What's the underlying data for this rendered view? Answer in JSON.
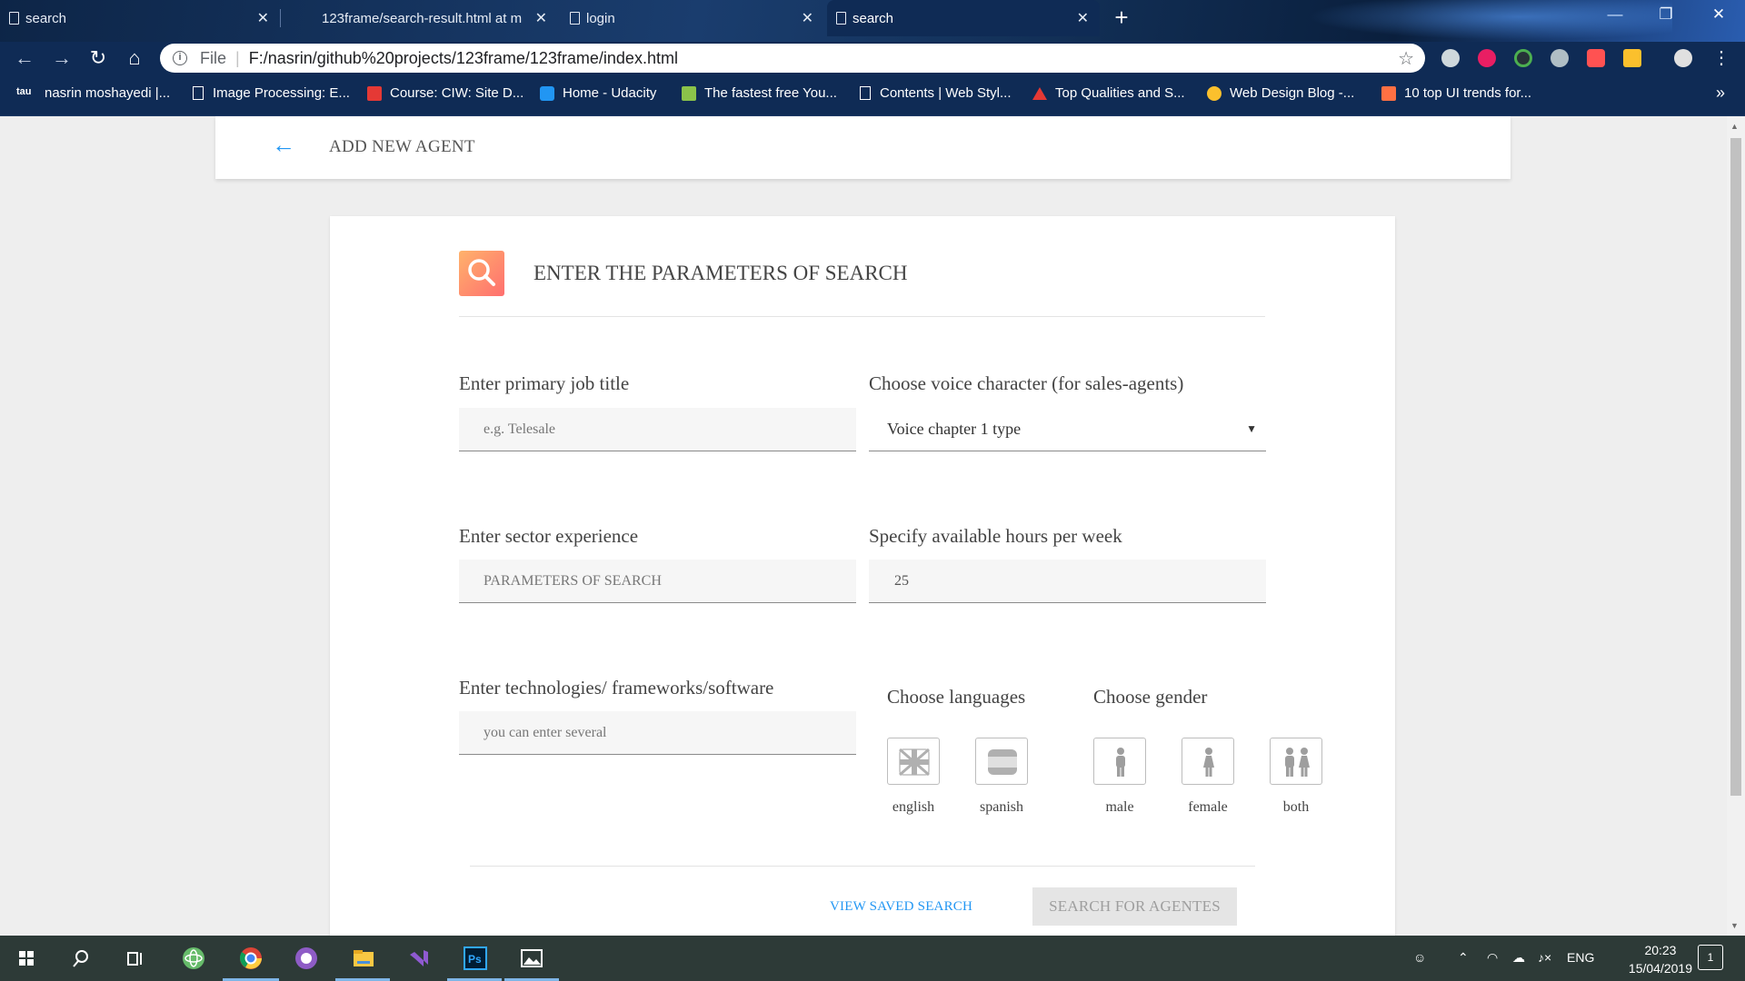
{
  "browser": {
    "tabs": [
      {
        "title": "search",
        "close": "✕"
      },
      {
        "title": "123frame/search-result.html at m",
        "close": "✕"
      },
      {
        "title": "login",
        "close": "✕"
      },
      {
        "title": "search",
        "close": "✕"
      }
    ],
    "new_tab": "+",
    "window_controls": {
      "minimize": "—",
      "restore": "❐",
      "close": "✕"
    },
    "address": {
      "scheme": "File",
      "separator": "|",
      "url": "F:/nasrin/github%20projects/123frame/123frame/index.html"
    },
    "bookmarks": [
      {
        "label": "nasrin moshayedi |...",
        "icon_color": "#ffffff"
      },
      {
        "label": "Image Processing: E...",
        "icon_color": ""
      },
      {
        "label": "Course: CIW: Site D...",
        "icon_color": "#e53935"
      },
      {
        "label": "Home - Udacity",
        "icon_color": "#2196f3"
      },
      {
        "label": "The fastest free You...",
        "icon_color": "#8bc34a"
      },
      {
        "label": "Contents | Web Styl...",
        "icon_color": ""
      },
      {
        "label": "Top Qualities and S...",
        "icon_color": "#e53935"
      },
      {
        "label": "Web Design Blog -...",
        "icon_color": "#fbc02d"
      },
      {
        "label": "10 top UI trends for...",
        "icon_color": "#ff7043"
      }
    ],
    "bookmarks_more": "»"
  },
  "page": {
    "header_title": "ADD NEW AGENT",
    "form_title": "ENTER THE PARAMETERS OF SEARCH",
    "fields": {
      "job_title": {
        "label": "Enter primary job title",
        "placeholder": "e.g. Telesale",
        "value": ""
      },
      "voice": {
        "label": "Choose voice character (for sales-agents)",
        "value": "Voice chapter 1 type",
        "caret": "▼"
      },
      "sector": {
        "label": "Enter sector experience",
        "placeholder": "PARAMETERS OF SEARCH",
        "value": ""
      },
      "hours": {
        "label": "Specify available hours per week",
        "value": "25"
      },
      "technologies": {
        "label": "Enter technologies/ frameworks/software",
        "placeholder": "you can enter several",
        "value": ""
      }
    },
    "languages": {
      "label": "Choose languages",
      "options": [
        {
          "label": "english",
          "icon": "uk-flag-icon"
        },
        {
          "label": "spanish",
          "icon": "spain-flag-icon"
        }
      ]
    },
    "gender": {
      "label": "Choose gender",
      "options": [
        {
          "label": "male",
          "icon": "male-icon"
        },
        {
          "label": "female",
          "icon": "female-icon"
        },
        {
          "label": "both",
          "icon": "couple-icon"
        }
      ]
    },
    "actions": {
      "view_saved": "VIEW SAVED SEARCH",
      "search": "SEARCH FOR AGENTES"
    },
    "colors": {
      "accent": "#2196f3",
      "badge_start": "#ffb26b",
      "badge_end": "#ff6f6f"
    }
  },
  "taskbar": {
    "tray_lang": "ENG",
    "time": "20:23",
    "date": "15/04/2019",
    "notifications": "1"
  }
}
